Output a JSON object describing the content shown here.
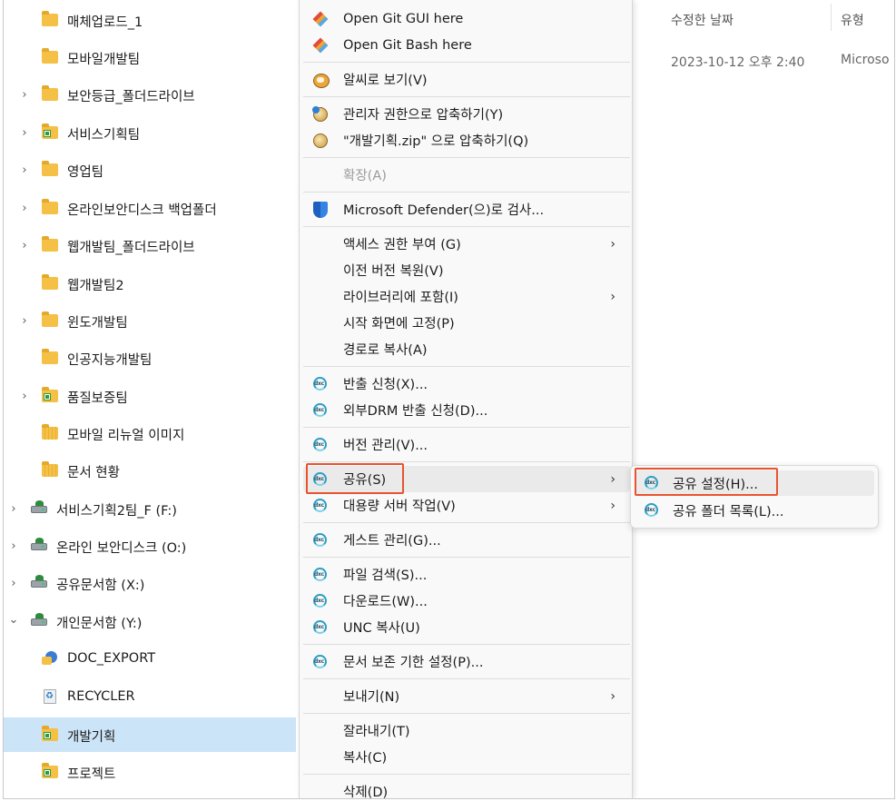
{
  "tree": [
    {
      "label": "매체업로드_1",
      "icon": "folder-icon",
      "chevron": false,
      "indent": 1
    },
    {
      "label": "모바일개발팀",
      "icon": "folder-icon",
      "chevron": false,
      "indent": 1
    },
    {
      "label": "보안등급_폴더드라이브",
      "icon": "folder-icon",
      "chevron": true,
      "indent": 1
    },
    {
      "label": "서비스기획팀",
      "icon": "shared-folder-icon",
      "chevron": true,
      "indent": 1
    },
    {
      "label": "영업팀",
      "icon": "folder-icon",
      "chevron": true,
      "indent": 1
    },
    {
      "label": "온라인보안디스크 백업폴더",
      "icon": "folder-icon",
      "chevron": true,
      "indent": 1
    },
    {
      "label": "웹개발팀_폴더드라이브",
      "icon": "folder-icon",
      "chevron": true,
      "indent": 1
    },
    {
      "label": "웹개발팀2",
      "icon": "folder-icon",
      "chevron": false,
      "indent": 1
    },
    {
      "label": "윈도개발팀",
      "icon": "folder-icon",
      "chevron": true,
      "indent": 1
    },
    {
      "label": "인공지능개발팀",
      "icon": "folder-icon",
      "chevron": false,
      "indent": 1
    },
    {
      "label": "품질보증팀",
      "icon": "shared-folder-icon",
      "chevron": true,
      "indent": 1
    },
    {
      "label": "모바일 리뉴얼 이미지",
      "icon": "striped-folder-icon",
      "chevron": false,
      "indent": 1
    },
    {
      "label": "문서 현황",
      "icon": "striped-folder-icon",
      "chevron": false,
      "indent": 1
    },
    {
      "label": "서비스기획2팀_F (F:)",
      "icon": "network-drive-icon",
      "chevron": true,
      "indent": 0
    },
    {
      "label": "온라인 보안디스크 (O:)",
      "icon": "network-drive-icon",
      "chevron": true,
      "indent": 0
    },
    {
      "label": "공유문서함 (X:)",
      "icon": "network-drive-icon",
      "chevron": true,
      "indent": 0
    },
    {
      "label": "개인문서함 (Y:)",
      "icon": "network-drive-icon",
      "chevron": "down",
      "indent": 0
    },
    {
      "label": "DOC_EXPORT",
      "icon": "globe-folder-icon",
      "chevron": false,
      "indent": 1
    },
    {
      "label": "RECYCLER",
      "icon": "recycle-icon",
      "chevron": false,
      "indent": 1
    },
    {
      "label": "개발기획",
      "icon": "shared-folder-icon",
      "chevron": false,
      "indent": 1,
      "selected": true
    },
    {
      "label": "프로젝트",
      "icon": "shared-folder-icon",
      "chevron": false,
      "indent": 1
    }
  ],
  "columns": {
    "modified_header": "수정한 날짜",
    "type_header": "유형",
    "modified_value": "2023-10-12 오후 2:40",
    "type_value": "Microso"
  },
  "menu": [
    {
      "label": "Open Git GUI here",
      "icon": "git-icon"
    },
    {
      "label": "Open Git Bash here",
      "icon": "git-icon"
    },
    {
      "sep": true
    },
    {
      "label": "알씨로 보기(V)",
      "icon": "alsee-icon"
    },
    {
      "sep": true
    },
    {
      "label": "관리자 권한으로 압축하기(Y)",
      "icon": "bandizip-admin-icon"
    },
    {
      "label": "\"개발기획.zip\" 으로 압축하기(Q)",
      "icon": "bandizip-icon"
    },
    {
      "sep": true
    },
    {
      "label": "확장(A)",
      "icon": "",
      "disabled": true
    },
    {
      "sep": true
    },
    {
      "label": "Microsoft Defender(으)로 검사...",
      "icon": "defender-shield-icon"
    },
    {
      "sep": true
    },
    {
      "label": "액세스 권한 부여 (G)",
      "icon": "",
      "submenu": true
    },
    {
      "label": "이전 버전 복원(V)",
      "icon": ""
    },
    {
      "label": "라이브러리에 포함(I)",
      "icon": "",
      "submenu": true
    },
    {
      "label": "시작 화면에 고정(P)",
      "icon": ""
    },
    {
      "label": "경로로 복사(A)",
      "icon": ""
    },
    {
      "sep": true
    },
    {
      "label": "반출 신청(X)...",
      "icon": "docs-icon"
    },
    {
      "label": "외부DRM 반출 신청(D)...",
      "icon": "docs-icon"
    },
    {
      "sep": true
    },
    {
      "label": "버전 관리(V)...",
      "icon": "docs-icon"
    },
    {
      "sep": true
    },
    {
      "label": "공유(S)",
      "icon": "docs-icon",
      "submenu": true,
      "hover": true
    },
    {
      "label": "대용량 서버 작업(V)",
      "icon": "docs-icon",
      "submenu": true
    },
    {
      "sep": true
    },
    {
      "label": "게스트 관리(G)...",
      "icon": "docs-icon"
    },
    {
      "sep": true
    },
    {
      "label": "파일 검색(S)...",
      "icon": "docs-icon"
    },
    {
      "label": "다운로드(W)...",
      "icon": "docs-icon"
    },
    {
      "label": "UNC 복사(U)",
      "icon": "docs-icon"
    },
    {
      "sep": true
    },
    {
      "label": "문서 보존 기한 설정(P)...",
      "icon": "docs-icon"
    },
    {
      "sep": true
    },
    {
      "label": "보내기(N)",
      "icon": "",
      "submenu": true
    },
    {
      "sep": true
    },
    {
      "label": "잘라내기(T)",
      "icon": ""
    },
    {
      "label": "복사(C)",
      "icon": ""
    },
    {
      "sep": true
    },
    {
      "label": "삭제(D)",
      "icon": ""
    }
  ],
  "submenu": [
    {
      "label": "공유 설정(H)...",
      "icon": "docs-icon",
      "hover": true
    },
    {
      "label": "공유 폴더 목록(L)...",
      "icon": "docs-icon"
    }
  ],
  "icon_text": {
    "docs": "dxc"
  },
  "glyphs": {
    "chevron_right": "›",
    "chevron_down": "⌄",
    "submenu_arrow": "›"
  },
  "colors": {
    "selection": "#cce4f7",
    "highlight_box": "#e8542f",
    "folder": "#f4c046"
  }
}
